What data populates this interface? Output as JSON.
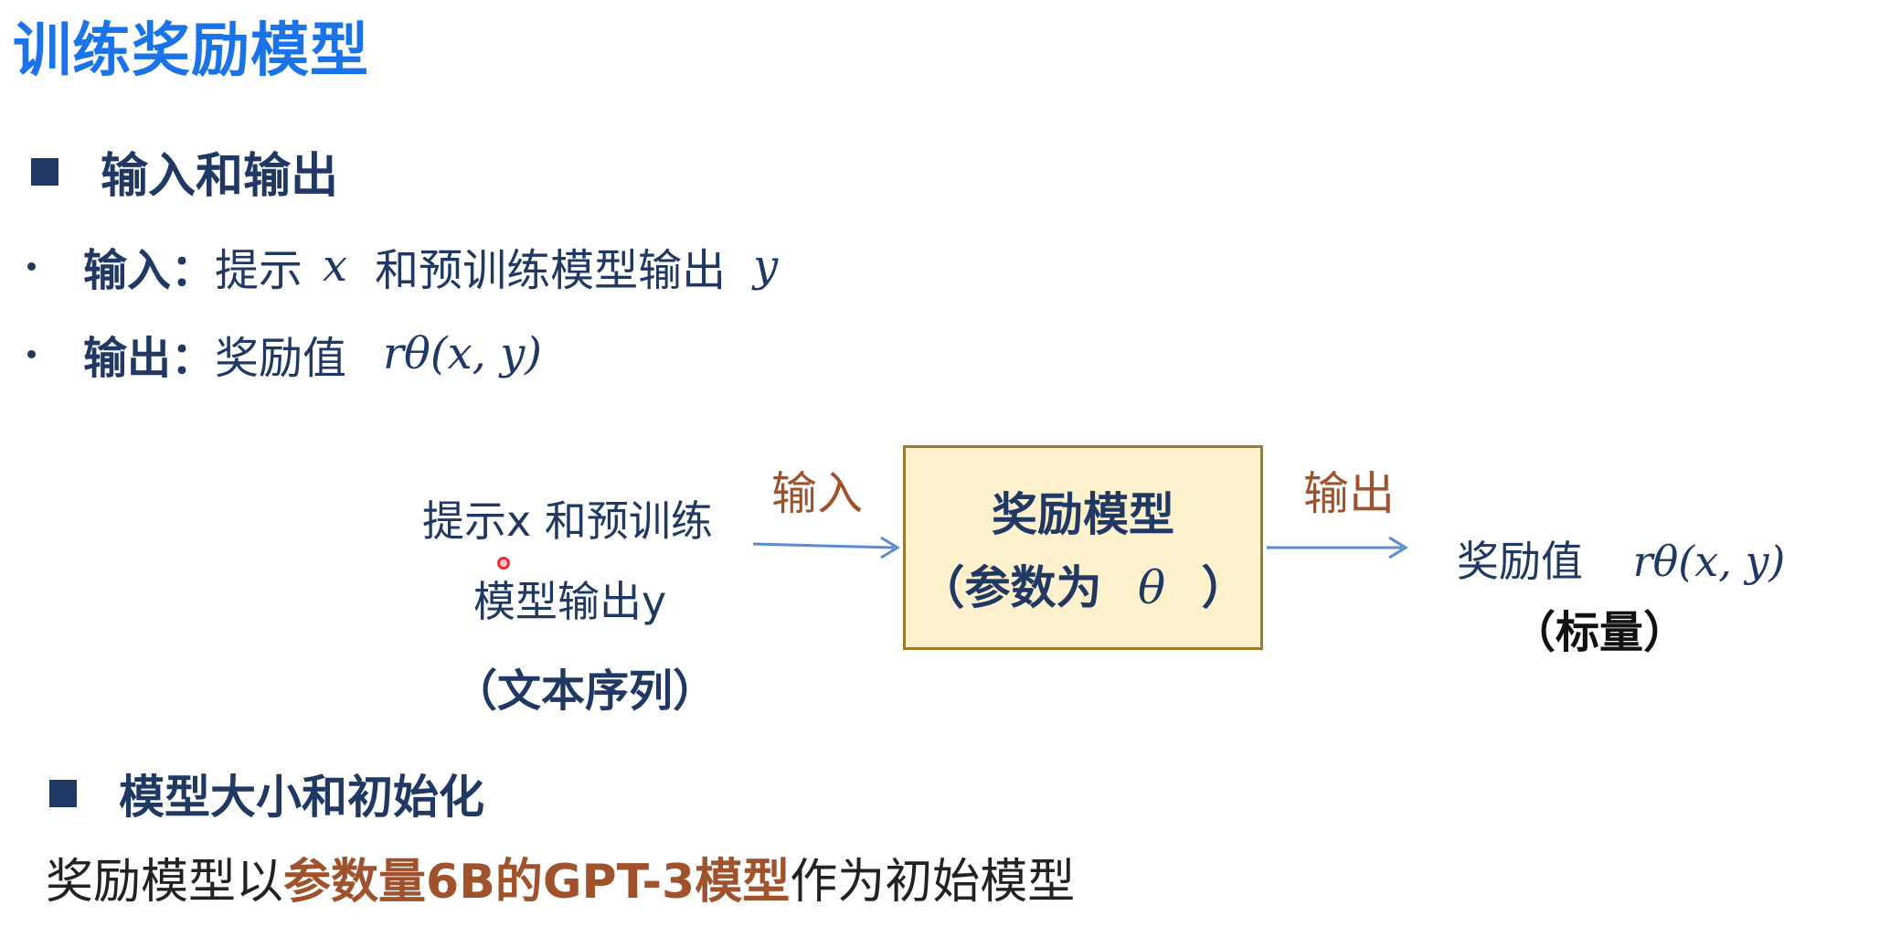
{
  "title": "训练奖励模型",
  "section1": {
    "heading": "输入和输出"
  },
  "bullets": [
    {
      "label": "输入：",
      "text_a": "提示",
      "math_a": "x",
      "text_b": "和预训练模型输出",
      "math_b": "y"
    },
    {
      "label": "输出：",
      "text_a": "奖励值",
      "math_a": "rθ(x, y)"
    }
  ],
  "diagram": {
    "input_line1": "提示x 和预训练",
    "input_line2": "模型输出y",
    "input_note": "（文本序列）",
    "arrow_in_label": "输入",
    "box_line1": "奖励模型",
    "box_line2_prefix": "（参数为",
    "box_line2_math": "θ",
    "box_line2_suffix": "）",
    "arrow_out_label": "输出",
    "output_text": "奖励值",
    "output_math": "rθ(x, y)",
    "output_note": "（标量）"
  },
  "section2": {
    "heading": "模型大小和初始化"
  },
  "bottom": {
    "prefix": "奖励模型以",
    "highlight": "参数量6B的GPT-3模型",
    "suffix": "作为初始模型"
  },
  "colors": {
    "title": "#1a73e8",
    "text": "#1f3864",
    "accent_brown": "#a0522d",
    "box_fill": "#fdf0cc",
    "box_border": "#9c7a2e",
    "arrow": "#5b8bd0"
  }
}
